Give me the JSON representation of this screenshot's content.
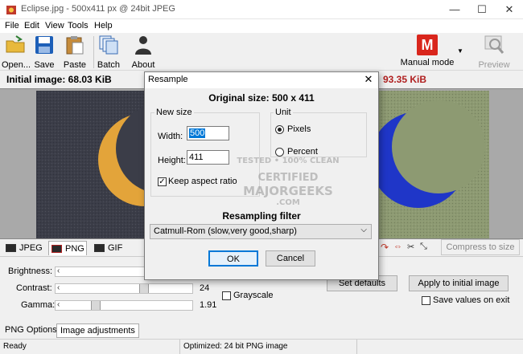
{
  "window": {
    "title": "Eclipse.jpg - 500x411 px @ 24bit JPEG",
    "minimize_glyph": "—",
    "maximize_glyph": "☐",
    "close_glyph": "✕"
  },
  "menu": [
    "File",
    "Edit",
    "View",
    "Tools",
    "Help"
  ],
  "toolbar": {
    "open_label": "Open...",
    "save_label": "Save",
    "paste_label": "Paste",
    "batch_label": "Batch",
    "about_label": "About",
    "mode_label": "Manual mode",
    "mode_icon_letter": "M",
    "preview_label": "Preview"
  },
  "info": {
    "initial_size": "Initial image:  68.03 KiB",
    "optimized_size": "93.35 KiB"
  },
  "format_tabs": [
    "JPEG",
    "PNG",
    "GIF"
  ],
  "compress_label": "Compress to size",
  "adjustments": {
    "brightness_label": "Brightness:",
    "contrast_label": "Contrast:",
    "contrast_value": "24",
    "gamma_label": "Gamma:",
    "gamma_value": "1.91",
    "grayscale_label": "Grayscale",
    "set_defaults_label": "Set defaults",
    "apply_label": "Apply to initial image",
    "save_values_label": "Save values on exit"
  },
  "bottom_tabs": [
    "PNG Options",
    "Image adjustments"
  ],
  "status": {
    "left": "Ready",
    "middle": "Optimized: 24 bit PNG image"
  },
  "dialog": {
    "title": "Resample",
    "close_glyph": "✕",
    "original_size": "Original size:  500 x 411",
    "new_size_group": "New size",
    "width_label": "Width:",
    "width_value": "500",
    "height_label": "Height:",
    "height_value": "411",
    "keep_aspect_label": "Keep aspect ratio",
    "unit_group": "Unit",
    "pixels_label": "Pixels",
    "percent_label": "Percent",
    "resampling_label": "Resampling filter",
    "filter_value": "Catmull-Rom (slow,very good,sharp)",
    "ok_label": "OK",
    "cancel_label": "Cancel"
  },
  "watermark": {
    "line1": "TESTED • 100% CLEAN",
    "line2": "CERTIFIED",
    "line3": "MAJORGEEKS",
    "line4": ".COM"
  },
  "colors": {
    "accent_red": "#d9261c",
    "selection_blue": "#0078d7",
    "optimized_text": "#b02020"
  }
}
